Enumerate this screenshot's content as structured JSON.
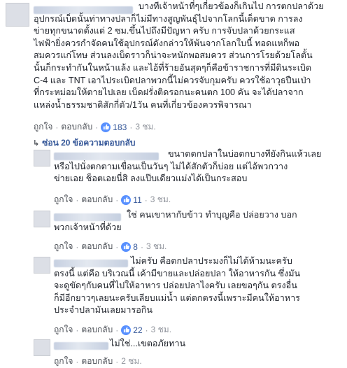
{
  "comment": {
    "text": "บางทีเจ้าหน้าที่ๆเกี่ยวข้องก็เกินไป การตกปลาด้วย\nอุปกรณ์เบ็ดนั้นท่าทางปลาก็ไม่มีทางสูญพันธุ์ไปจากโลกนี้เด็ดขาด การลง\nข่ายทุกขนาดตั้งแต่ 2 ซม.ขึ้นไปถึงมีปัญหา ครับ การจับปลาด้วยกระแส\nไฟฟ้ายิ่งควรกำจัดคนใช้อุปกรณ์ดังกล่าวให้พ้นจากโลกใบนี้ ทอดแหก็พอ\nสมควรแก่โทษ ส่วนลงเบ็ดราวก็น่าจะหนักพอสมควร ส่วนการโรยด้วยโลตั้น\nนั้นก็กระทำกันในหน้าแล้ง และไอ้ที่ร้ายอันสุดๆก็คือข้าราชการที่มีดินระเบิด\nC-4 และ TNT เอาไประเบิดปลาพวกนี้ไม่ควรจับกุมครับ ควรใช้อาวุธปืนเป่า\nที่กระหม่อมให้ตายไปเลย เบ็ดฝรั่งติดรอกนะคนตก 100 คัน จะได้ปลาจาก\nแหล่งน้ำธรรมชาติสักกี่ตัว/1วัน คนที่เกี่ยวข้องควรพิจารณา",
    "like": "ถูกใจ",
    "reply": "ตอบกลับ",
    "likes": "183",
    "time": "3 ชม."
  },
  "hidden_replies": "ซ่อน 20 ข้อความตอบกลับ",
  "replies": [
    {
      "text": "ขนาดตกปลาในบ่อตกบางทียังกินแห้วเลย\nหรือไปนั่งตกตามเขื่อนเป็นวันๆ ไม่ได้สักตัวก็บ่อย แต่ไอ้พวกวาง\nข่ายเอย ช็อตเอยนี่สิ ลงแป๊บเดียวแม่งได้เป็นกระสอบ",
      "likes": "11",
      "time": "3 ชม."
    },
    {
      "text": "ใช่ คนเขาหากับข้าว ทำบุญคือ ปล่อยวาง บอก\nพวกเจ้าหน้าที่ด้วย",
      "likes": "8",
      "time": "3 ชม."
    },
    {
      "text": "ไม่ครับ คือตกปลาประมงก็ไม่ได้ห้ามนะครับ\nตรงนี้ แต่คือ บริเวณนี้ เค้ามีขายและปล่อยปลา ให้อาหารกัน ซึ่งมัน\nจะดูขัดๆกับคนที่ไปให้อาหาร ปล่อยปลาไงครับ เลยขอๆกัน ตรงอื่น\nก็มีอีกยาวๆเลยนะครับเลียบแม่น้ำ แต่ตกตรงนี้เพราะมีคนให้อาหาร\nประจำปลามันเลยมารอกิน",
      "likes": "22",
      "time": "3 ชม."
    },
    {
      "text": "ไม่ใช่...เขตอภัยทาน",
      "time": "2 ชม."
    }
  ],
  "labels": {
    "like": "ถูกใจ",
    "reply": "ตอบกลับ"
  },
  "colors": {
    "link": "#365899",
    "meta": "#90949c",
    "like_badge": "#5890ff"
  },
  "icons": [
    "thumbs-up-icon",
    "corner-arrow-icon"
  ]
}
